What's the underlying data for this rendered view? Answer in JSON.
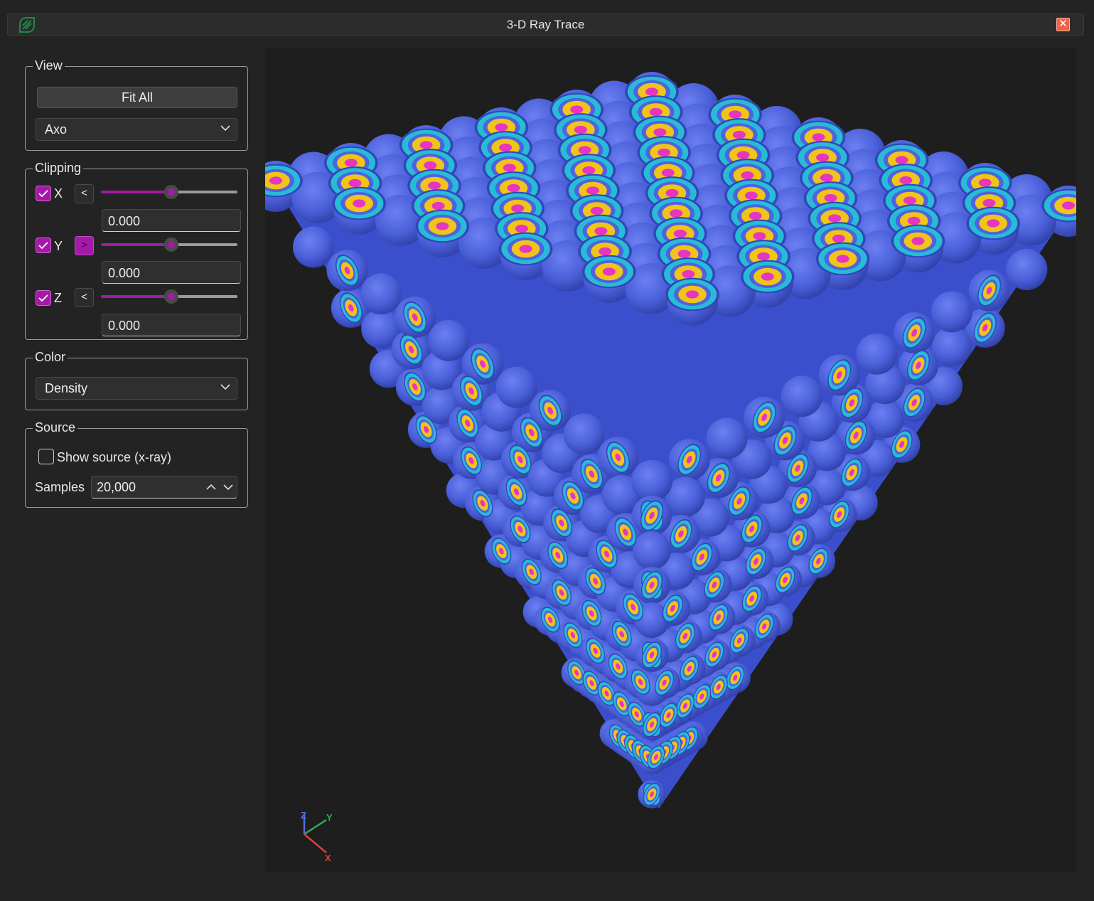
{
  "window": {
    "title": "3-D Ray Trace",
    "close_label": "✕"
  },
  "view": {
    "legend": "View",
    "fit_all_label": "Fit All",
    "projection": "Axo"
  },
  "clipping": {
    "legend": "Clipping",
    "axes": [
      {
        "label": "X",
        "enabled": true,
        "direction": "<",
        "direction_active": false,
        "value": "0.000",
        "slider_level": 0.5
      },
      {
        "label": "Y",
        "enabled": true,
        "direction": ">",
        "direction_active": true,
        "value": "0.000",
        "slider_level": 0.5
      },
      {
        "label": "Z",
        "enabled": true,
        "direction": "<",
        "direction_active": false,
        "value": "0.000",
        "slider_level": 0.5
      }
    ]
  },
  "color": {
    "legend": "Color",
    "mode": "Density"
  },
  "source": {
    "legend": "Source",
    "show_source_label": "Show source (x-ray)",
    "show_source_checked": false,
    "samples_label": "Samples",
    "samples_value": "20,000"
  },
  "triad": {
    "z": "Z",
    "y": "Y",
    "x": "X"
  },
  "colors": {
    "accent": "#a41aa8",
    "sphere_blue": "#4d63e0",
    "ring_cyan": "#27bcd6",
    "ring_yellow": "#f1c419",
    "core_magenta": "#e636c0",
    "axis_x": "#d84040",
    "axis_y": "#2fae4f",
    "axis_z": "#4d6fe0"
  },
  "icons": {
    "app": "leaf-logo-icon",
    "close": "close-icon",
    "dropdown": "chevron-down-icon",
    "spin_up": "chevron-up-icon",
    "check": "check-icon"
  }
}
